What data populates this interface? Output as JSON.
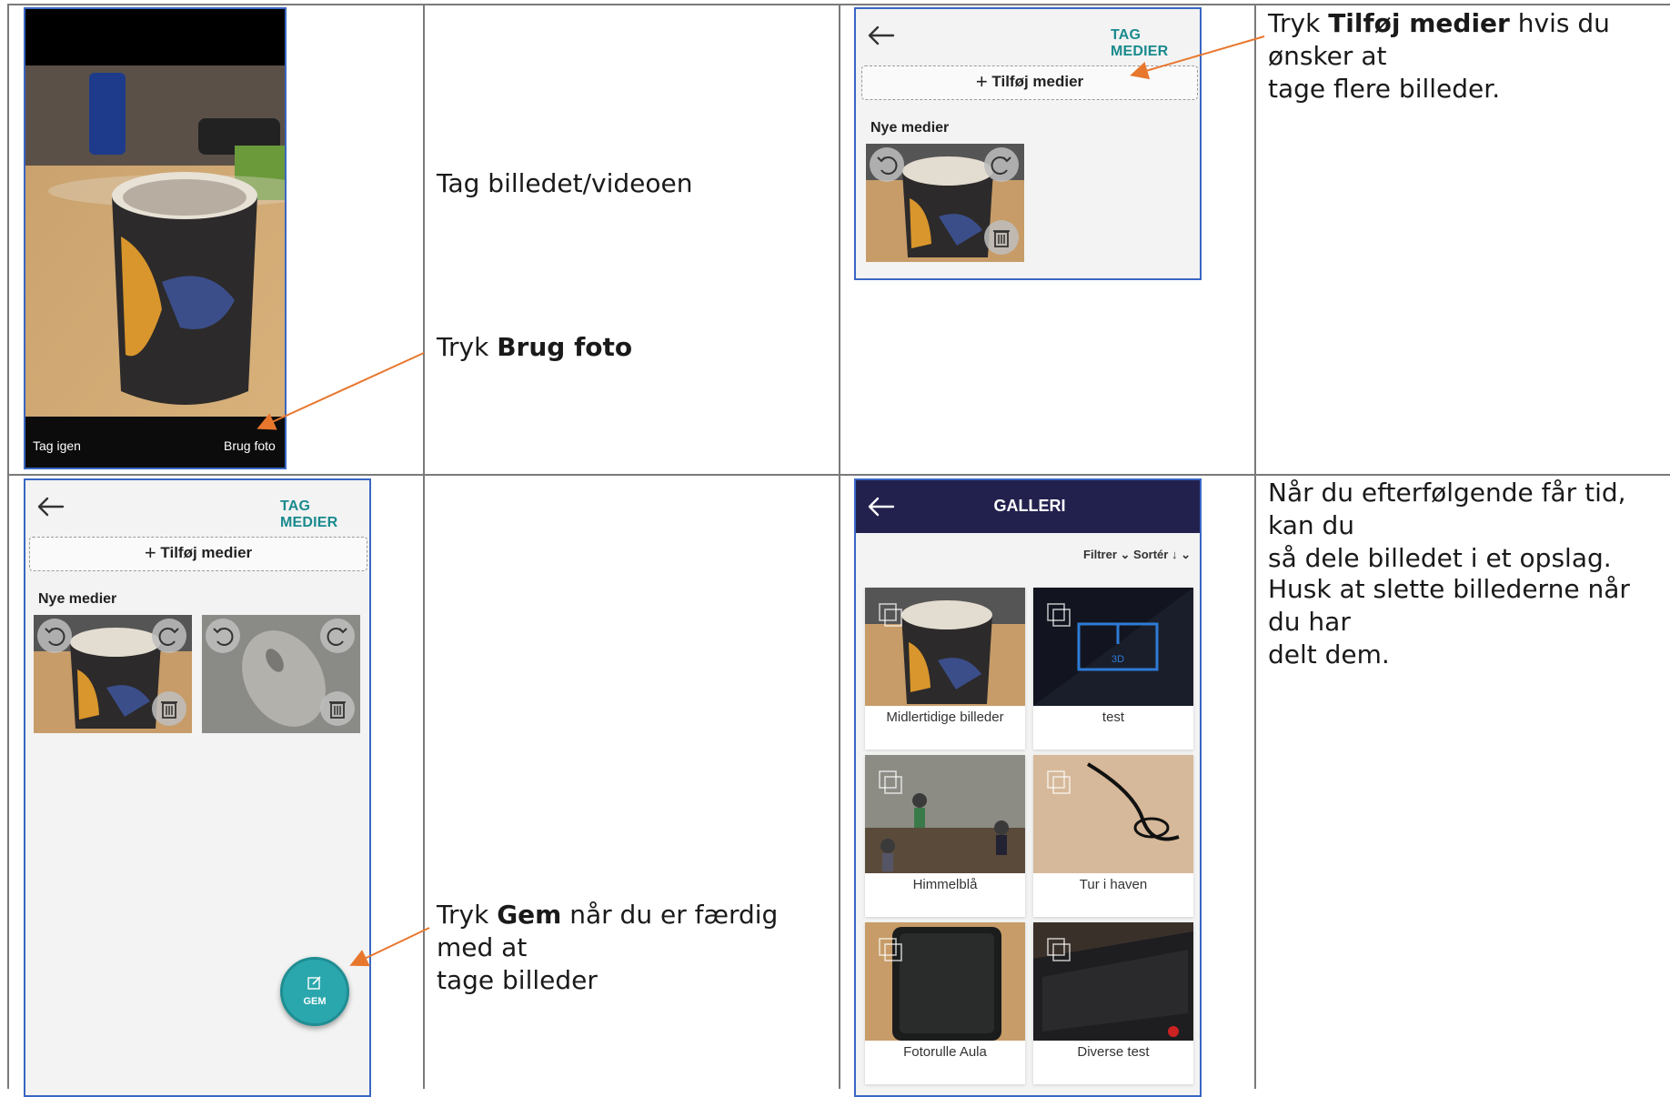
{
  "row1": {
    "camera": {
      "retake_label": "Tag igen",
      "use_label": "Brug foto"
    },
    "caption_take": "Tag billedet/videoen",
    "caption_use_prefix": "Tryk ",
    "caption_use_bold": "Brug foto",
    "phone": {
      "header_action": "TAG MEDIER",
      "add_media": "Tilføj medier",
      "section_label": "Nye medier"
    },
    "caption_add_prefix": "Tryk ",
    "caption_add_bold": "Tilføj medier",
    "caption_add_line1_rest": " hvis du ønsker at",
    "caption_add_line2": "tage flere billeder."
  },
  "row2": {
    "phone": {
      "header_action": "TAG MEDIER",
      "add_media": "Tilføj medier",
      "section_label": "Nye medier",
      "save_label": "GEM"
    },
    "caption_save_prefix": "Tryk ",
    "caption_save_bold": "Gem",
    "caption_save_line1_rest": " når du er færdig med at",
    "caption_save_line2": "tage billeder",
    "gallery": {
      "title": "GALLERI",
      "filter_label": "Filtrer",
      "sort_label": "Sortér",
      "albums": [
        {
          "name": "Midlertidige billeder"
        },
        {
          "name": "test"
        },
        {
          "name": "Himmelblå"
        },
        {
          "name": "Tur i haven"
        },
        {
          "name": "Fotorulle Aula"
        },
        {
          "name": "Diverse test"
        }
      ]
    },
    "caption_share_line1": "Når du efterfølgende får tid, kan du",
    "caption_share_line2": "så dele billedet i et opslag.",
    "caption_delete_line1": "Husk at slette billederne når du har",
    "caption_delete_line2": "delt dem."
  },
  "colors": {
    "accent_teal": "#1a8a8e",
    "arrow_orange": "#e8772e",
    "frame_blue": "#3a66c4",
    "gallery_header": "#22204d"
  }
}
